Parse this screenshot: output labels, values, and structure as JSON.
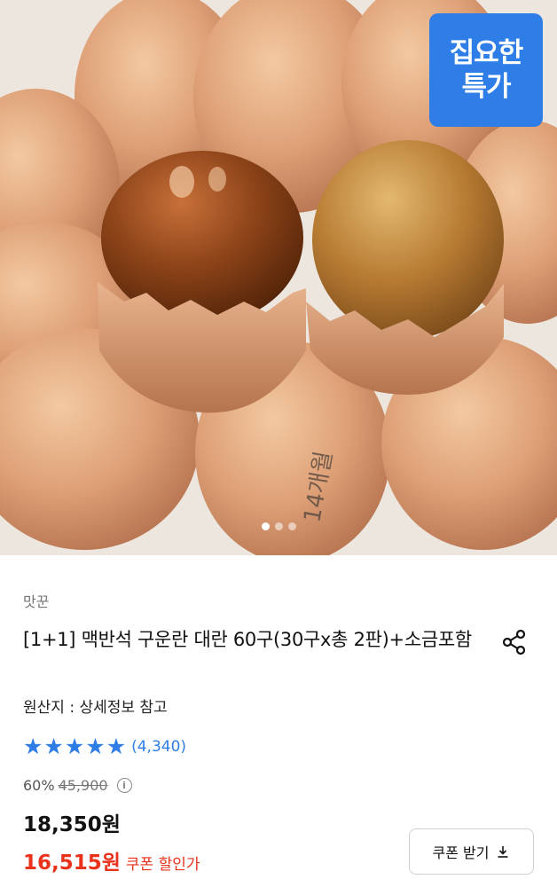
{
  "product_image": {
    "badge_line1": "집요한",
    "badge_line2": "특가",
    "egg_stamp": "14개월",
    "carousel_dots": 3,
    "active_dot": 1
  },
  "product": {
    "seller": "맛꾼",
    "title": "[1+1] 맥반석 구운란 대란 60구(30구x총 2판)+소금포함",
    "origin": "원산지 : 상세정보 참고",
    "rating_stars": 5,
    "review_count": "(4,340)",
    "discount_rate": "60%",
    "original_price": "45,900",
    "sale_price": "18,350원",
    "coupon_price": "16,515원",
    "coupon_label": "쿠폰 할인가",
    "coupon_button_label": "쿠폰 받기"
  },
  "colors": {
    "accent_blue": "#2f7de6",
    "coupon_red": "#e8321c"
  }
}
